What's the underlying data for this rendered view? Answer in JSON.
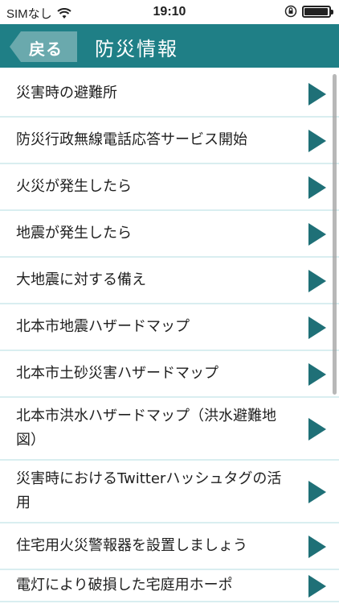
{
  "status": {
    "carrier": "SIMなし",
    "time": "19:10",
    "battery_level": 0.95
  },
  "header": {
    "back_label": "戻る",
    "title": "防災情報",
    "color": "#1f7f86"
  },
  "list": {
    "items": [
      {
        "label": "災害時の避難所"
      },
      {
        "label": "防災行政無線電話応答サービス開始"
      },
      {
        "label": "火災が発生したら"
      },
      {
        "label": "地震が発生したら"
      },
      {
        "label": "大地震に対する備え"
      },
      {
        "label": "北本市地震ハザードマップ"
      },
      {
        "label": "北本市土砂災害ハザードマップ"
      },
      {
        "label": "北本市洪水ハザードマップ（洪水避難地図）"
      },
      {
        "label": "災害時におけるTwitterハッシュタグの活用"
      },
      {
        "label": "住宅用火災警報器を設置しましょう"
      },
      {
        "label": "電灯により破損した宅庭用ホーポ"
      }
    ]
  }
}
